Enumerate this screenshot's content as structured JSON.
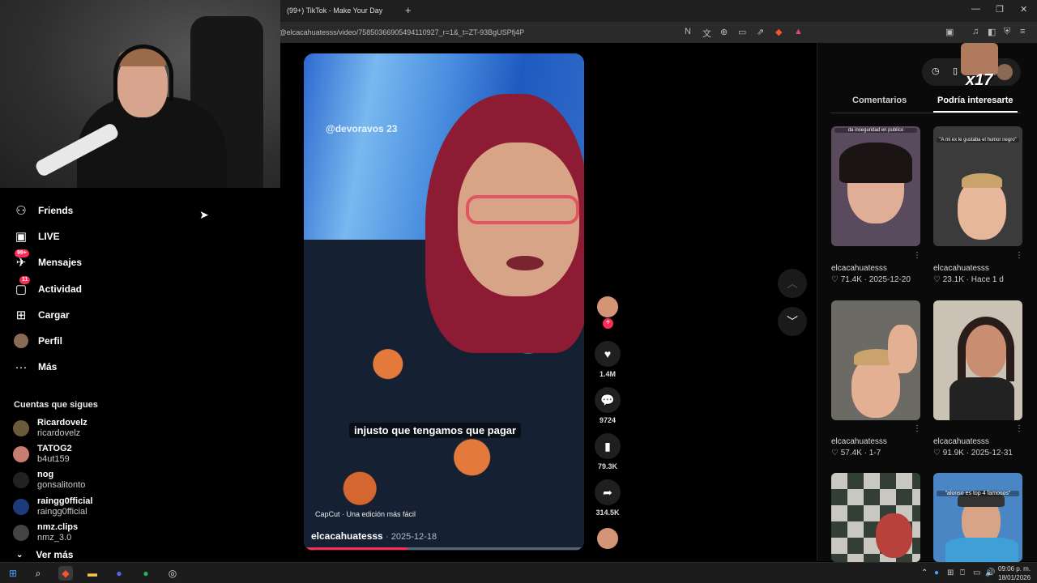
{
  "browser": {
    "tab_title": "(99+) TikTok - Make Your Day",
    "new_tab": "+",
    "url": "/@elcacahuatesss/video/75850366905494110927_r=1&_t=ZT-93BgUSPfj4P"
  },
  "nav": {
    "items": [
      {
        "label": "Friends",
        "icon": "friends-icon",
        "glyph": "👥"
      },
      {
        "label": "LIVE",
        "icon": "live-icon",
        "glyph": "▣"
      },
      {
        "label": "Mensajes",
        "icon": "messages-icon",
        "glyph": "✈",
        "badge": "99+"
      },
      {
        "label": "Actividad",
        "icon": "activity-icon",
        "glyph": "▢",
        "badge": "11"
      },
      {
        "label": "Cargar",
        "icon": "upload-icon",
        "glyph": "⊞"
      },
      {
        "label": "Perfil",
        "icon": "profile-icon",
        "glyph": "●"
      },
      {
        "label": "Más",
        "icon": "more-icon",
        "glyph": "···"
      }
    ],
    "following_title": "Cuentas que sigues",
    "accounts": [
      {
        "name": "Ricardovelz",
        "handle": "ricardovelz",
        "color": "#6b5a3a"
      },
      {
        "name": "TATOG2",
        "handle": "b4ut159",
        "color": "#c77d6f"
      },
      {
        "name": "nog",
        "handle": "gonsalitonto",
        "color": "#222222"
      },
      {
        "name": "raingg0fficial",
        "handle": "raingg0fficial",
        "color": "#1d3a7a"
      },
      {
        "name": "nmz.clips",
        "handle": "nmz_3.0",
        "color": "#444444"
      }
    ],
    "see_more": "Ver más"
  },
  "video": {
    "watermark": "@devoravos 23",
    "caption": "injusto que tengamos que pagar",
    "capcut": "CapCut · Una edición más fácil",
    "author": "elcacahuatesss",
    "date": "· 2025-12-18",
    "progress": 0.37
  },
  "actions": {
    "likes": "1.4M",
    "comments": "9724",
    "saves": "79.3K",
    "shares": "314.5K"
  },
  "right": {
    "overlay_text": "x17",
    "tab_comments": "Comentarios",
    "tab_suggested": "Podría interesarte",
    "videos": [
      {
        "author": "elcacahuatesss",
        "likes": "71.4K",
        "date": "2025-12-20",
        "text": "da inseguridad en publico",
        "bg": "#5a4a5e",
        "face": "#e0ad97"
      },
      {
        "author": "elcacahuatesss",
        "likes": "23.1K",
        "date": "Hace 1 d",
        "text": "\"A mi ex le gustaba el humor negro\"",
        "bg": "#3b3b3b",
        "face": "#e7b79b"
      },
      {
        "author": "elcacahuatesss",
        "likes": "57.4K",
        "date": "1-7",
        "text": "",
        "bg": "#6c6a64",
        "face": "#e4b094"
      },
      {
        "author": "elcacahuatesss",
        "likes": "91.9K",
        "date": "2025-12-31",
        "text": "",
        "bg": "#c9c2b5",
        "face": "#c98e72"
      },
      {
        "author": "",
        "likes": "",
        "date": "",
        "text": "",
        "bg": "#8a8a84",
        "face": "#b8413c"
      },
      {
        "author": "",
        "likes": "",
        "date": "",
        "text": "\"alonso es top 4 famosos\"",
        "bg": "#4a86c4",
        "face": "#d7a487"
      }
    ]
  },
  "taskbar": {
    "time": "09:06 p. m.",
    "date": "18/01/2026"
  }
}
